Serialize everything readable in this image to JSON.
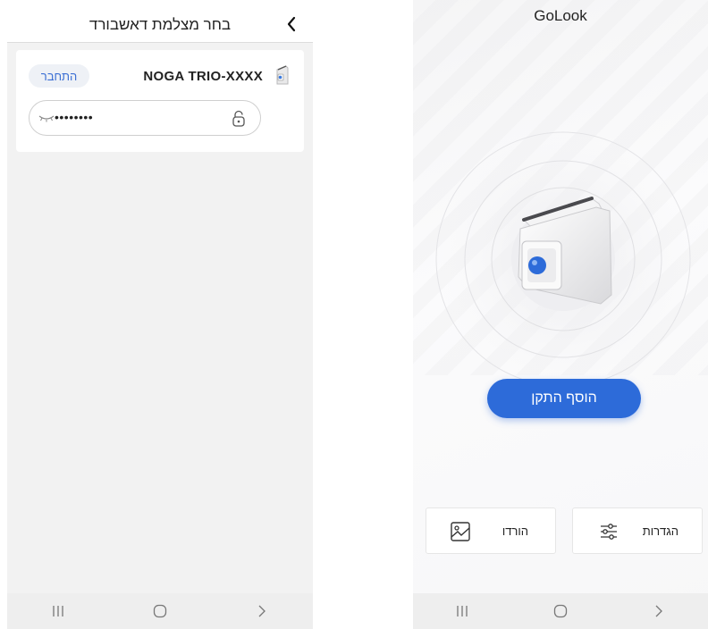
{
  "left_screen": {
    "header": {
      "title": "בחר מצלמת דאשבורד"
    },
    "device": {
      "name": "NOGA TRIO-XXXX",
      "connect_label": "התחבר",
      "password_value": "••••••••"
    },
    "nav": {
      "recent": "|||",
      "home": "◯",
      "back": "〈"
    }
  },
  "right_screen": {
    "app_title": "GoLook",
    "add_device_label": "הוסף התקן",
    "tiles": {
      "settings_label": "הגדרות",
      "downloads_label": "הורדו"
    },
    "nav": {
      "recent": "|||",
      "home": "◯",
      "back": "〈"
    }
  },
  "colors": {
    "accent_blue": "#2d6bd9",
    "connect_text": "#3b6fd4",
    "background_gray": "#f2f2f2"
  },
  "icons": {
    "back": "chevron-right-icon",
    "device": "dashcam-icon",
    "eye": "eye-closed-icon",
    "lock": "lock-icon",
    "settings": "sliders-icon",
    "downloads": "image-icon"
  }
}
